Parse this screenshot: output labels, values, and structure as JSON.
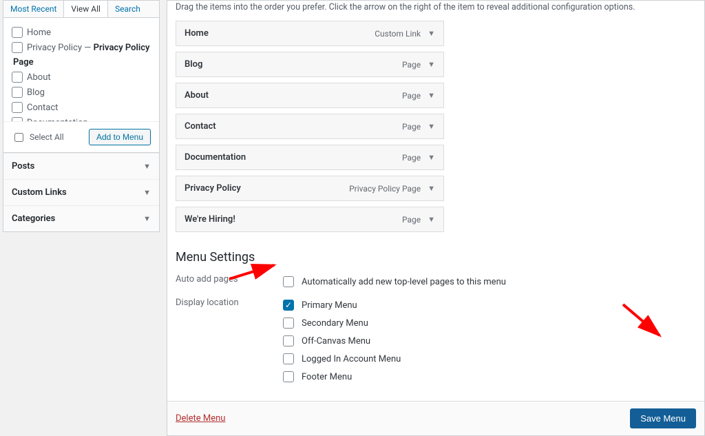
{
  "tabs": {
    "most_recent": "Most Recent",
    "view_all": "View All",
    "search": "Search"
  },
  "pages": {
    "home": "Home",
    "privacy_prefix": "Privacy Policy — ",
    "privacy_bold": "Privacy Policy",
    "group": "Page",
    "about": "About",
    "blog": "Blog",
    "contact": "Contact",
    "documentation": "Documentation",
    "hiring": "We're Hiring!"
  },
  "select_all": "Select All",
  "add_to_menu": "Add to Menu",
  "accordion": {
    "posts": "Posts",
    "custom_links": "Custom Links",
    "categories": "Categories"
  },
  "instruction": "Drag the items into the order you prefer. Click the arrow on the right of the item to reveal additional configuration options.",
  "menu": {
    "home": {
      "title": "Home",
      "type": "Custom Link"
    },
    "blog": {
      "title": "Blog",
      "type": "Page"
    },
    "about": {
      "title": "About",
      "type": "Page"
    },
    "contact": {
      "title": "Contact",
      "type": "Page"
    },
    "docs": {
      "title": "Documentation",
      "type": "Page"
    },
    "privacy": {
      "title": "Privacy Policy",
      "type": "Privacy Policy Page"
    },
    "hiring": {
      "title": "We're Hiring!",
      "type": "Page"
    }
  },
  "settings": {
    "title": "Menu Settings",
    "auto_label": "Auto add pages",
    "auto_text": "Automatically add new top-level pages to this menu",
    "display_label": "Display location",
    "loc": {
      "primary": "Primary Menu",
      "secondary": "Secondary Menu",
      "offcanvas": "Off-Canvas Menu",
      "account": "Logged In Account Menu",
      "footer": "Footer Menu"
    }
  },
  "delete_menu": "Delete Menu",
  "save_menu": "Save Menu"
}
